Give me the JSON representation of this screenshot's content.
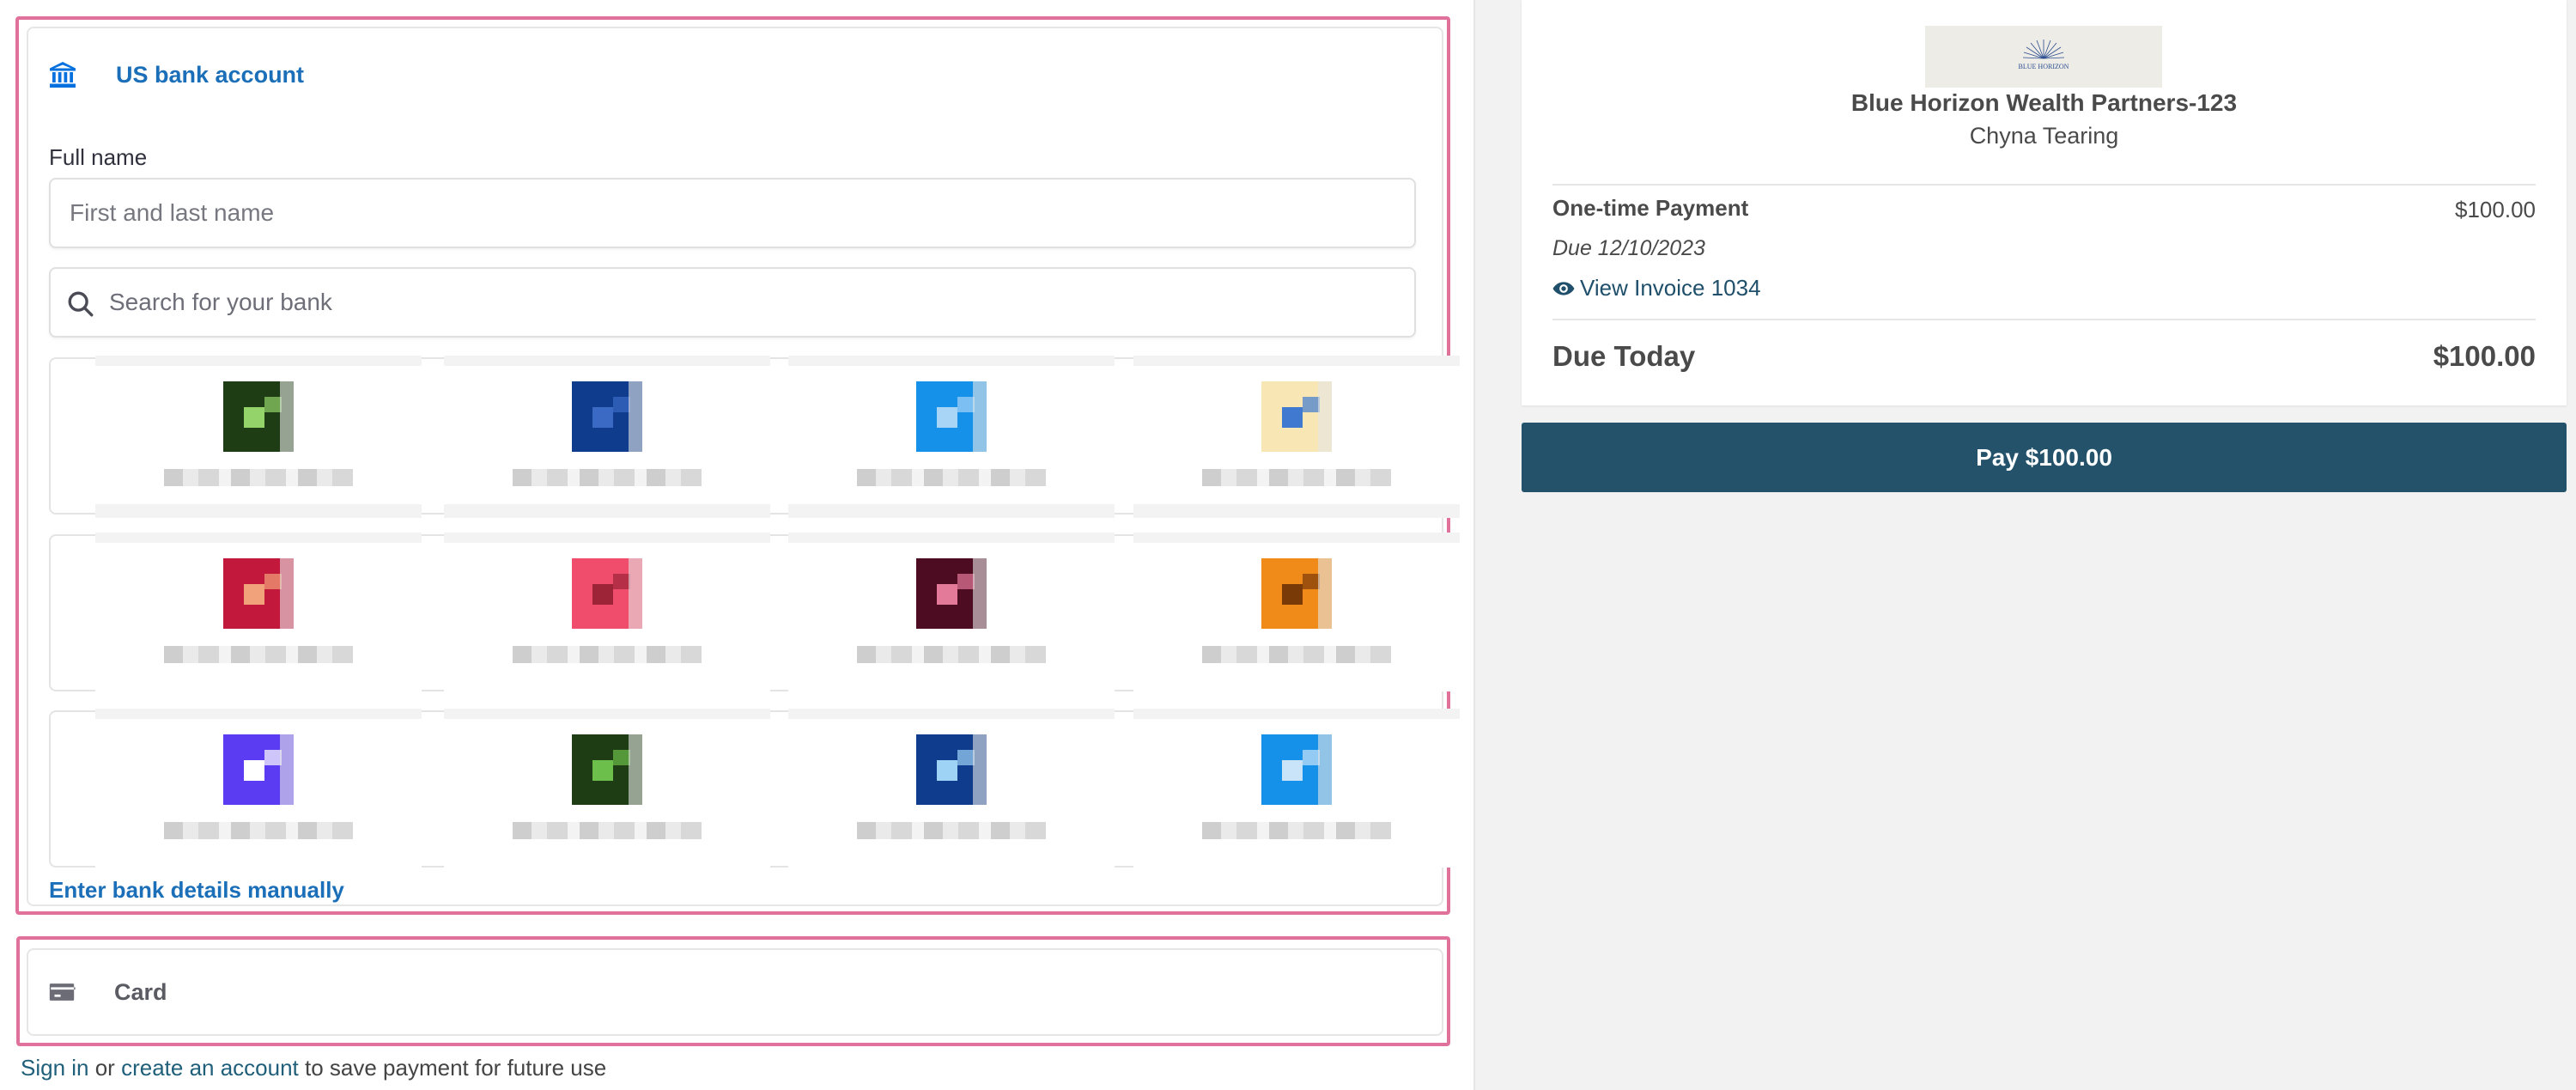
{
  "payment_methods": {
    "bank": {
      "title": "US bank account",
      "icon": "bank-icon",
      "full_name_label": "Full name",
      "full_name_placeholder": "First and last name",
      "search_placeholder": "Search for your bank",
      "manual_link": "Enter bank details manually",
      "banks": [
        {
          "color": "#1e3d14",
          "accent": "#93d36a"
        },
        {
          "color": "#0f3c8c",
          "accent": "#3a6ac4"
        },
        {
          "color": "#1591ea",
          "accent": "#a8d4f6"
        },
        {
          "color": "#f8e7b4",
          "accent": "#3f7ad0"
        },
        {
          "color": "#c2183c",
          "accent": "#f2a27a"
        },
        {
          "color": "#ef4d6b",
          "accent": "#9c2436"
        },
        {
          "color": "#4d0c22",
          "accent": "#e47a9a"
        },
        {
          "color": "#f08a18",
          "accent": "#7a3a08"
        },
        {
          "color": "#5b3cf2",
          "accent": "#ffffff"
        },
        {
          "color": "#1e3d14",
          "accent": "#6cbf4a"
        },
        {
          "color": "#0f3c8c",
          "accent": "#9ed3f5"
        },
        {
          "color": "#1591ea",
          "accent": "#c9e4f9"
        }
      ]
    },
    "card": {
      "label": "Card",
      "icon": "credit-card-icon"
    },
    "signin": {
      "sign_in": "Sign in",
      "or": " or ",
      "create_account": "create an account",
      "suffix": " to save payment for future use"
    }
  },
  "summary": {
    "merchant": "Blue Horizon Wealth Partners-123",
    "customer": "Chyna Tearing",
    "logo_text": "BLUE HORIZON",
    "payment_type": "One-time Payment",
    "payment_amount": "$100.00",
    "due_date": "Due 12/10/2023",
    "view_invoice": "View Invoice 1034",
    "due_today_label": "Due Today",
    "due_today_amount": "$100.00"
  },
  "pay_button": "Pay $100.00",
  "colors": {
    "accent_link": "#1a6fb8",
    "pay_button": "#23526a",
    "highlight_outline": "#e0719b"
  }
}
